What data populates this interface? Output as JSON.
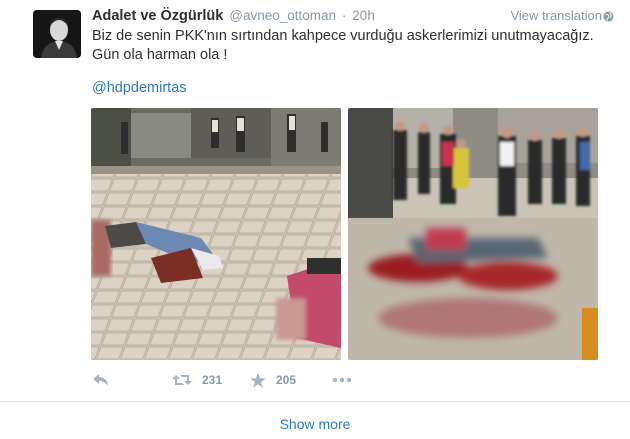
{
  "author": {
    "fullname": "Adalet ve Özgürlük",
    "handle": "@avneo_ottoman",
    "separator": "·",
    "time": "20h"
  },
  "view_translation": "View translation",
  "tweet": {
    "line1": "Biz de senin PKK'nın sırtından kahpece  vurduğu askerlerimizi unutmayacağız.",
    "line2": "Gün ola harman ola !",
    "mention": "@hdpdemirtas"
  },
  "actions": {
    "reply_icon": "reply-icon",
    "retweet_icon": "retweet-icon",
    "retweet_count": "231",
    "favorite_icon": "star-icon",
    "favorite_count": "205",
    "more_icon": "more-icon"
  },
  "show_more": "Show more",
  "colors": {
    "link": "#2b7bb9",
    "muted": "#8899a6",
    "icon": "#a8b4bd",
    "text": "#292f33"
  }
}
